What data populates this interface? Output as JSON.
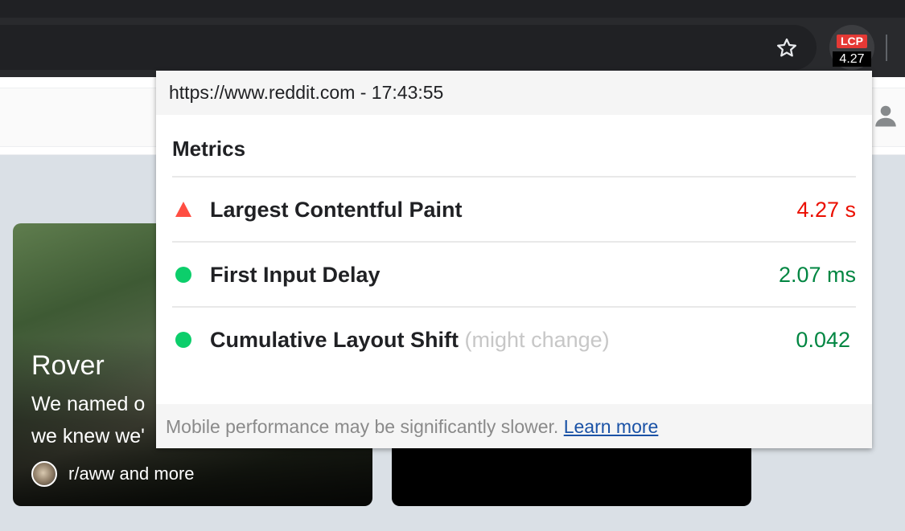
{
  "browser": {
    "star_icon": "star-outline-icon",
    "extension": {
      "badge_label": "LCP",
      "badge_value": "4.27",
      "badge_color": "#e53935"
    }
  },
  "page": {
    "user_icon": "user-silhouette-icon",
    "card": {
      "title": "Rover",
      "desc_line1": "We named o",
      "desc_line2": "we knew we'",
      "subreddit": "r/aww and more"
    }
  },
  "popup": {
    "url_line": "https://www.reddit.com - 17:43:55",
    "metrics_title": "Metrics",
    "metrics": [
      {
        "status": "poor",
        "icon": "warning-triangle-icon",
        "name": "Largest Contentful Paint",
        "note": "",
        "value": "4.27 s",
        "color": "#eb0f00"
      },
      {
        "status": "good",
        "icon": "green-dot-icon",
        "name": "First Input Delay",
        "note": "",
        "value": "2.07 ms",
        "color": "#018642"
      },
      {
        "status": "good",
        "icon": "green-dot-icon",
        "name": "Cumulative Layout Shift",
        "note": "(might change)",
        "value": "0.042",
        "color": "#018642"
      }
    ],
    "footer": {
      "text": "Mobile performance may be significantly slower.",
      "link": "Learn more"
    }
  }
}
